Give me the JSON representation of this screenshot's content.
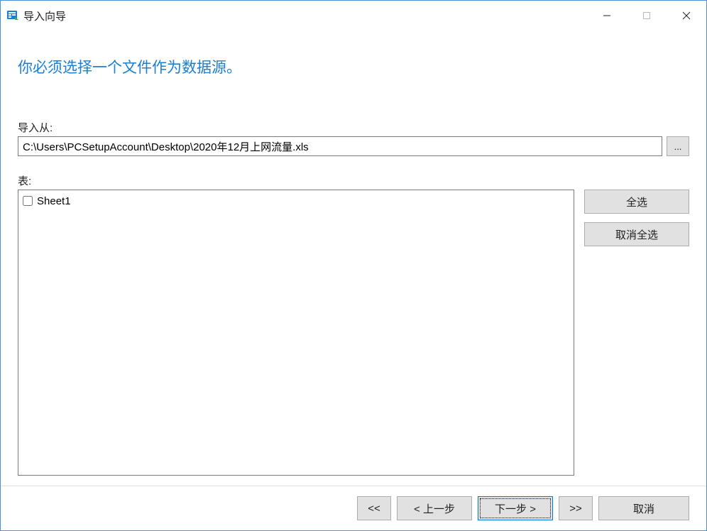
{
  "titlebar": {
    "title": "导入向导"
  },
  "instruction": "你必须选择一个文件作为数据源。",
  "importFrom": {
    "label": "导入从:",
    "value": "C:\\Users\\PCSetupAccount\\Desktop\\2020年12月上网流量.xls",
    "browse": "..."
  },
  "tables": {
    "label": "表:",
    "items": [
      {
        "name": "Sheet1",
        "checked": false
      }
    ],
    "selectAll": "全选",
    "deselectAll": "取消全选"
  },
  "footer": {
    "first": "<<",
    "prev": "< 上一步",
    "next": "下一步 >",
    "last": ">>",
    "cancel": "取消"
  }
}
